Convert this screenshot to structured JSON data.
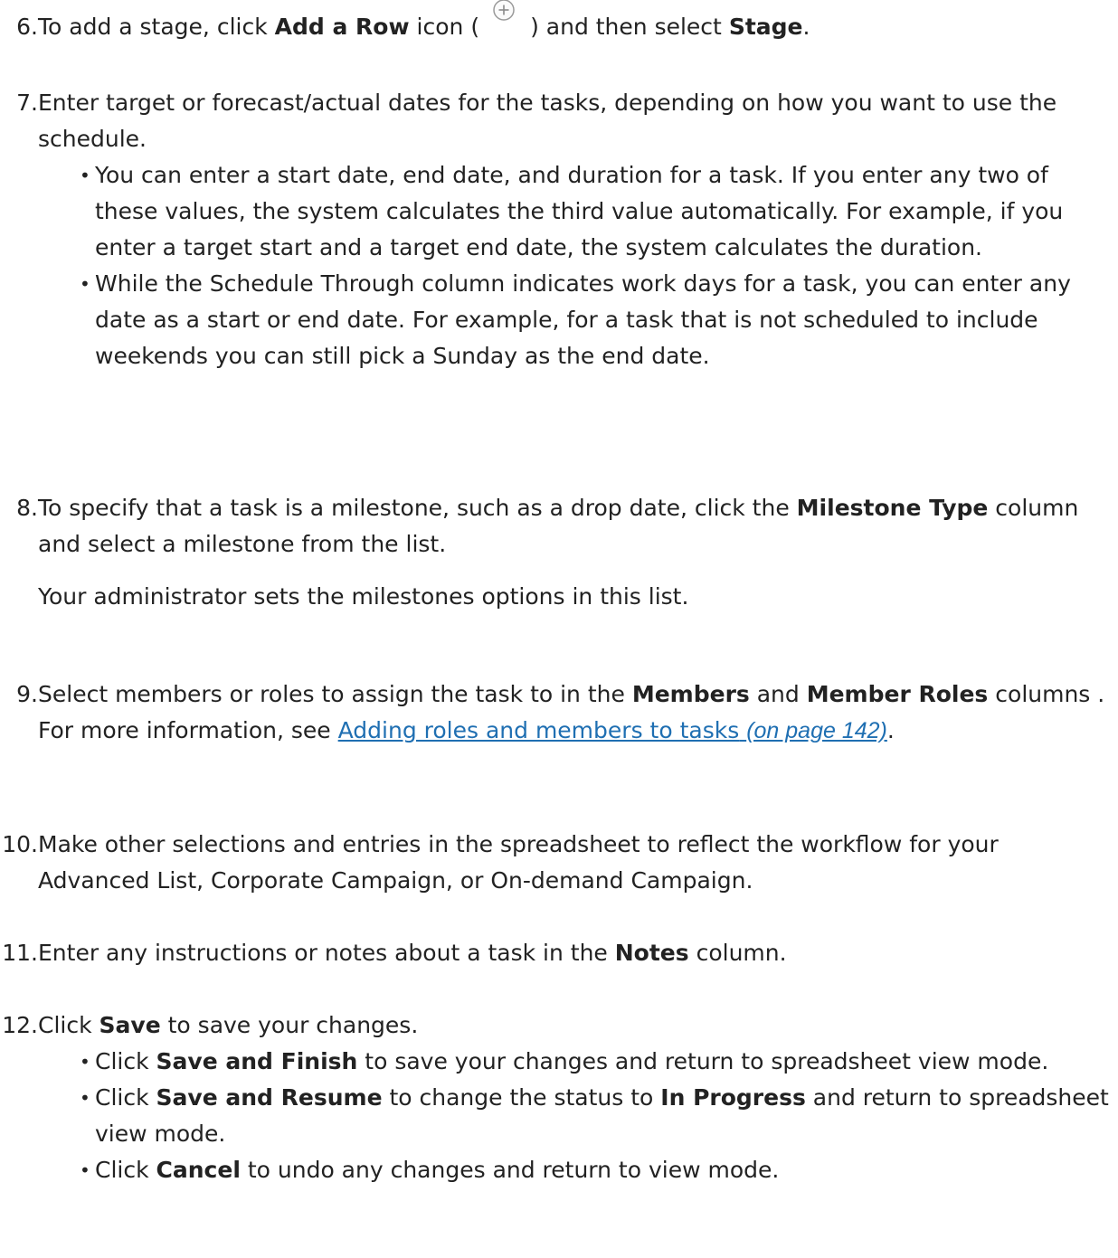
{
  "steps": {
    "s6": {
      "num": "6.",
      "t1": "To add a stage, click ",
      "b1": "Add a Row",
      "t2": " icon (",
      "t3": ") and then select ",
      "b2": "Stage",
      "t4": "."
    },
    "s7": {
      "num": "7.",
      "text": "Enter target or forecast/actual dates for the tasks, depending on how you want to use the schedule.",
      "bullets": [
        "You can enter a start date, end date, and duration for a task. If you enter any two of these values, the system calculates the third value automatically. For example, if you enter a target start and a target end date, the system calculates the duration.",
        "While the Schedule Through column indicates work days for a task, you can enter any date as a start or end date. For example, for a task that is not scheduled to include weekends you can still pick a Sunday as the end date."
      ]
    },
    "s8": {
      "num": "8.",
      "t1": "To specify that a task is a milestone, such as a drop date, click the ",
      "b1": "Milestone Type",
      "t2": " column and select a milestone from the list.",
      "note": "Your administrator sets the milestones options in this list."
    },
    "s9": {
      "num": "9.",
      "t1": "Select members or roles to assign the task to in the ",
      "b1": "Members",
      "t2": " and ",
      "b2": "Member Roles",
      "t3": " columns .",
      "t4": "For more information, see ",
      "link_text": "Adding roles and members to tasks",
      "link_page": "(on page 142)",
      "t5": "."
    },
    "s10": {
      "num": "10.",
      "text": "Make other selections and entries in the spreadsheet to reflect the workflow for your Advanced List, Corporate Campaign, or On-demand Campaign."
    },
    "s11": {
      "num": "11.",
      "t1": "Enter any instructions or notes about a task in the ",
      "b1": "Notes",
      "t2": " column."
    },
    "s12": {
      "num": "12.",
      "t1": "Click ",
      "b1": "Save",
      "t2": " to save your changes.",
      "bullet1": {
        "t1": "Click ",
        "b1": "Save and Finish",
        "t2": " to save your changes and return to spreadsheet view mode."
      },
      "bullet2": {
        "t1": "Click ",
        "b1": "Save and Resume",
        "t2": " to change the status to ",
        "b2": "In Progress",
        "t3": " and return to spreadsheet view mode."
      },
      "bullet3": {
        "t1": "Click ",
        "b1": "Cancel",
        "t2": " to undo any changes and return to view mode."
      }
    }
  },
  "icons": {
    "add_row": "add-row-plus-circle-icon"
  },
  "colors": {
    "text": "#222222",
    "link": "#1f6fb2",
    "icon": "#9a9a9a"
  }
}
